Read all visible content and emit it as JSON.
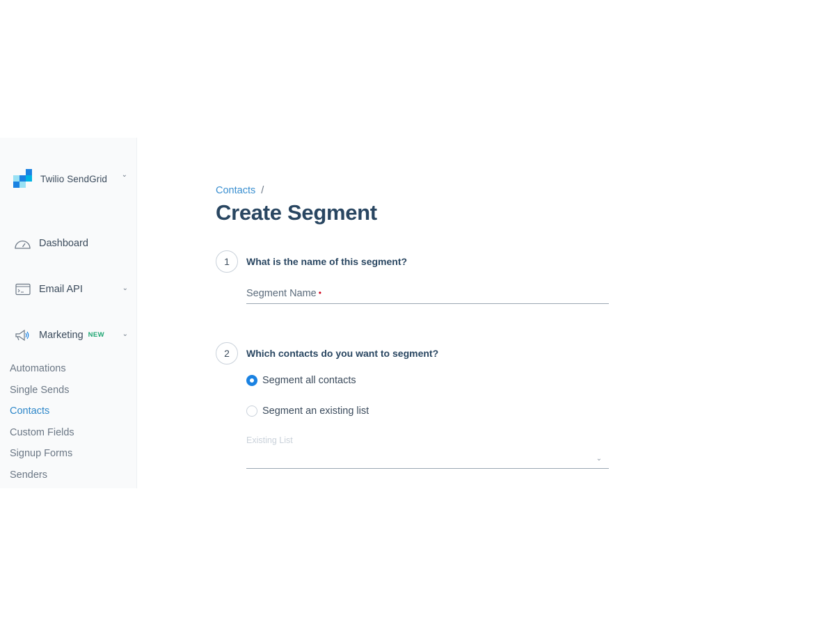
{
  "brand": {
    "name": "Twilio SendGrid",
    "icon": "sendgrid-logo"
  },
  "nav": {
    "dashboard": {
      "label": "Dashboard",
      "icon": "gauge-icon"
    },
    "email_api": {
      "label": "Email API",
      "icon": "terminal-window-icon"
    },
    "marketing": {
      "label": "Marketing",
      "badge": "NEW",
      "icon": "megaphone-icon"
    },
    "sub_items": [
      "Automations",
      "Single Sends",
      "Contacts",
      "Custom Fields",
      "Signup Forms",
      "Senders"
    ],
    "active_sub_item": "Contacts"
  },
  "breadcrumb": {
    "parent": "Contacts",
    "separator": "/"
  },
  "page_title": "Create Segment",
  "step1": {
    "number": "1",
    "question": "What is the name of this segment?",
    "field_label": "Segment Name",
    "required_marker": "•",
    "value": ""
  },
  "step2": {
    "number": "2",
    "question": "Which contacts do you want to segment?",
    "options": [
      "Segment all contacts",
      "Segment an existing list"
    ],
    "selected_option": "Segment all contacts",
    "list_field_label": "Existing List",
    "list_field_value": ""
  },
  "colors": {
    "accent": "#1a82e2",
    "link": "#3a8fd0",
    "title": "#294661",
    "new_badge": "#1ea672",
    "required": "#d0021b"
  }
}
